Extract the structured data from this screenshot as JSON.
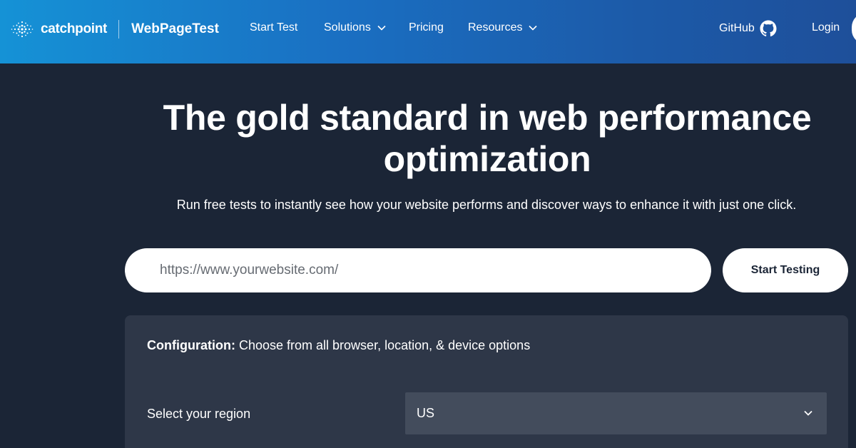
{
  "header": {
    "brand": "catchpoint",
    "product": "WebPageTest",
    "nav": [
      {
        "label": "Start Test",
        "dropdown": false
      },
      {
        "label": "Solutions",
        "dropdown": true
      },
      {
        "label": "Pricing",
        "dropdown": false
      },
      {
        "label": "Resources",
        "dropdown": true
      }
    ],
    "github_label": "GitHub",
    "login_label": "Login",
    "icons": [
      "catchpoint-logo-icon",
      "chevron-down-icon",
      "github-icon"
    ]
  },
  "hero": {
    "title_line1": "The gold standard in web performance",
    "title_line2": "optimization",
    "subtitle": "Run free tests to instantly see how your website performs and discover ways to enhance it with just one click."
  },
  "url_form": {
    "placeholder": "https://www.yourwebsite.com/",
    "value": "",
    "submit_label": "Start Testing"
  },
  "config": {
    "label_bold": "Configuration:",
    "label_rest": " Choose from all browser, location, & device options",
    "region_label": "Select your region",
    "region_value": "US"
  },
  "colors": {
    "header_gradient_start": "#1592d6",
    "header_gradient_end": "#1e4f9a",
    "page_background": "#1b2536",
    "panel_background": "#2e3748",
    "select_background": "#434c5c"
  }
}
